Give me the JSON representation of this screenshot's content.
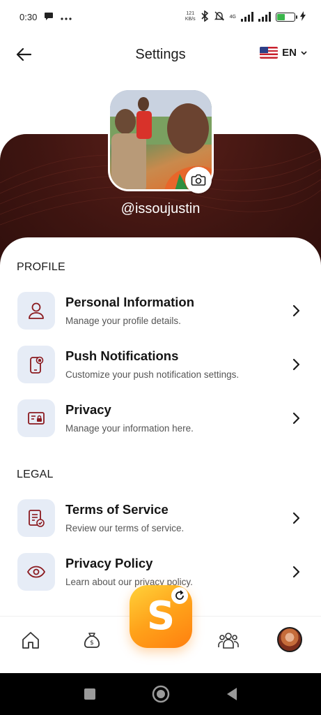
{
  "status_bar": {
    "time": "0:30",
    "net_speed_value": "121",
    "net_speed_unit": "KB/s",
    "network_type": "4G",
    "battery_label": "20"
  },
  "header": {
    "title": "Settings",
    "language": "EN"
  },
  "profile": {
    "username": "@issoujustin"
  },
  "sections": {
    "profile_title": "PROFILE",
    "legal_title": "LEGAL"
  },
  "items": [
    {
      "title": "Personal Information",
      "subtitle": "Manage your profile details."
    },
    {
      "title": "Push Notifications",
      "subtitle": "Customize your push notification settings."
    },
    {
      "title": "Privacy",
      "subtitle": "Manage your information here."
    },
    {
      "title": "Terms of Service",
      "subtitle": "Review our terms of service."
    },
    {
      "title": "Privacy Policy",
      "subtitle": "Learn about our privacy policy."
    }
  ],
  "bottom_nav": {
    "center_logo": "S"
  },
  "colors": {
    "accent": "#8b1a1f",
    "banner": "#3f1511",
    "icon_bg": "#e6ecf6",
    "center_button": "#ffa21a"
  },
  "icons": {
    "back": "arrow-left-icon",
    "camera": "camera-icon",
    "personal": "user-icon",
    "push": "phone-bell-icon",
    "privacy": "id-card-lock-icon",
    "terms": "document-check-icon",
    "policy": "eye-icon",
    "home": "home-icon",
    "money": "money-bag-icon",
    "community": "group-icon",
    "refresh": "refresh-icon"
  }
}
